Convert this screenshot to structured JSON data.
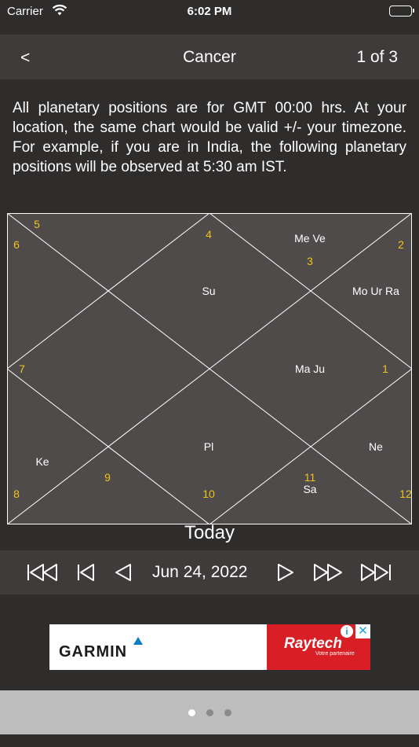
{
  "status_bar": {
    "carrier": "Carrier",
    "time": "6:02 PM"
  },
  "nav": {
    "back_label": "<",
    "title": "Cancer",
    "page_count": "1 of 3"
  },
  "info_text": "All planetary positions are for GMT 00:00 hrs. At your location, the same chart would be valid +/- your timezone. For example, if you are in India, the following planetary positions will be observed at 5:30 am IST.",
  "chart": {
    "houses": {
      "h1": "1",
      "h2": "2",
      "h3": "3",
      "h4": "4",
      "h5": "5",
      "h6": "6",
      "h7": "7",
      "h8": "8",
      "h9": "9",
      "h10": "10",
      "h11": "11",
      "h12": "12"
    },
    "planets": {
      "h1": "Ma Ju",
      "h2": "Mo Ur Ra",
      "h3": "Me Ve",
      "h4": "Su",
      "h10": "Pl",
      "h11": "Sa",
      "h12": "Ne",
      "h8": "Ke"
    },
    "colors": {
      "background": "#4f4b4b",
      "lines": "#ffffff",
      "house_numbers": "#f2c21b",
      "planets": "#ffffff"
    }
  },
  "today_label": "Today",
  "date_bar": {
    "date": "Jun 24, 2022",
    "controls": [
      "first-icon",
      "step-back-icon",
      "prev-icon",
      "next-icon",
      "fast-forward-icon",
      "last-icon"
    ]
  },
  "ad": {
    "advertiser": "GARMIN",
    "brand": "Raytech",
    "tagline": "Votre partenaire",
    "info_icon": "i",
    "close_icon": "✕"
  },
  "pager": {
    "pages": 3,
    "current": 1,
    "active_color": "#ffffff",
    "inactive_color": "#8a8a8a"
  }
}
